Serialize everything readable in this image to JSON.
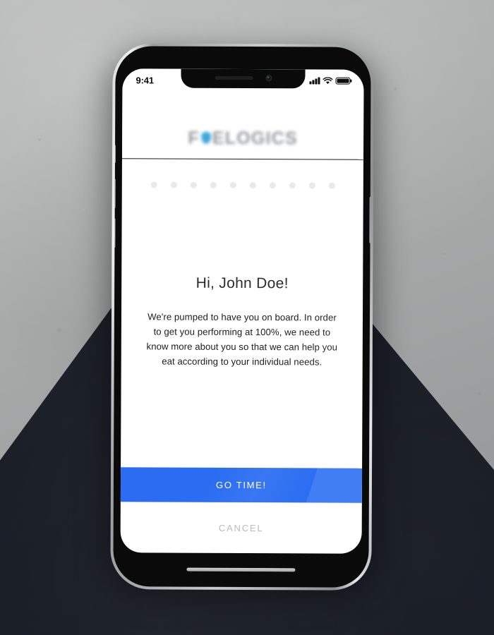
{
  "scene": {
    "background_concrete_color": "#a9aaaa",
    "background_dark_panel_color": "#181c25"
  },
  "device": {
    "frame_color": "#c9cbcc",
    "body_color": "#0a0a0b",
    "notch": {
      "earpiece": "earpiece-speaker",
      "camera": "front-camera"
    },
    "buttons": {
      "mute_switch": "mute-switch",
      "volume_up": "volume-up-button",
      "volume_down": "volume-down-button",
      "power": "power-button"
    },
    "bottom_grille": "speaker-grille"
  },
  "statusbar": {
    "time": "9:41",
    "cellular_icon": "signal-bars-icon",
    "wifi_icon": "wifi-icon",
    "battery_icon": "battery-icon"
  },
  "app": {
    "logo": {
      "text": "FUELOGICS",
      "icon": "water-drop-icon",
      "icon_color": "#2f9fd6",
      "text_color": "#8d9094"
    },
    "progress": {
      "total_steps": 10,
      "current_step": 1,
      "dot_color": "#e9e9e9"
    },
    "main": {
      "greeting": "Hi, John Doe!",
      "body": "We're pumped to have you on board. In order to get you performing at 100%, we need to know more about you so that we can help you eat according to your individual needs."
    },
    "actions": {
      "primary_label": "GO TIME!",
      "primary_color": "#2a6df2",
      "secondary_label": "CANCEL",
      "secondary_color": "#b6b6b6"
    }
  }
}
